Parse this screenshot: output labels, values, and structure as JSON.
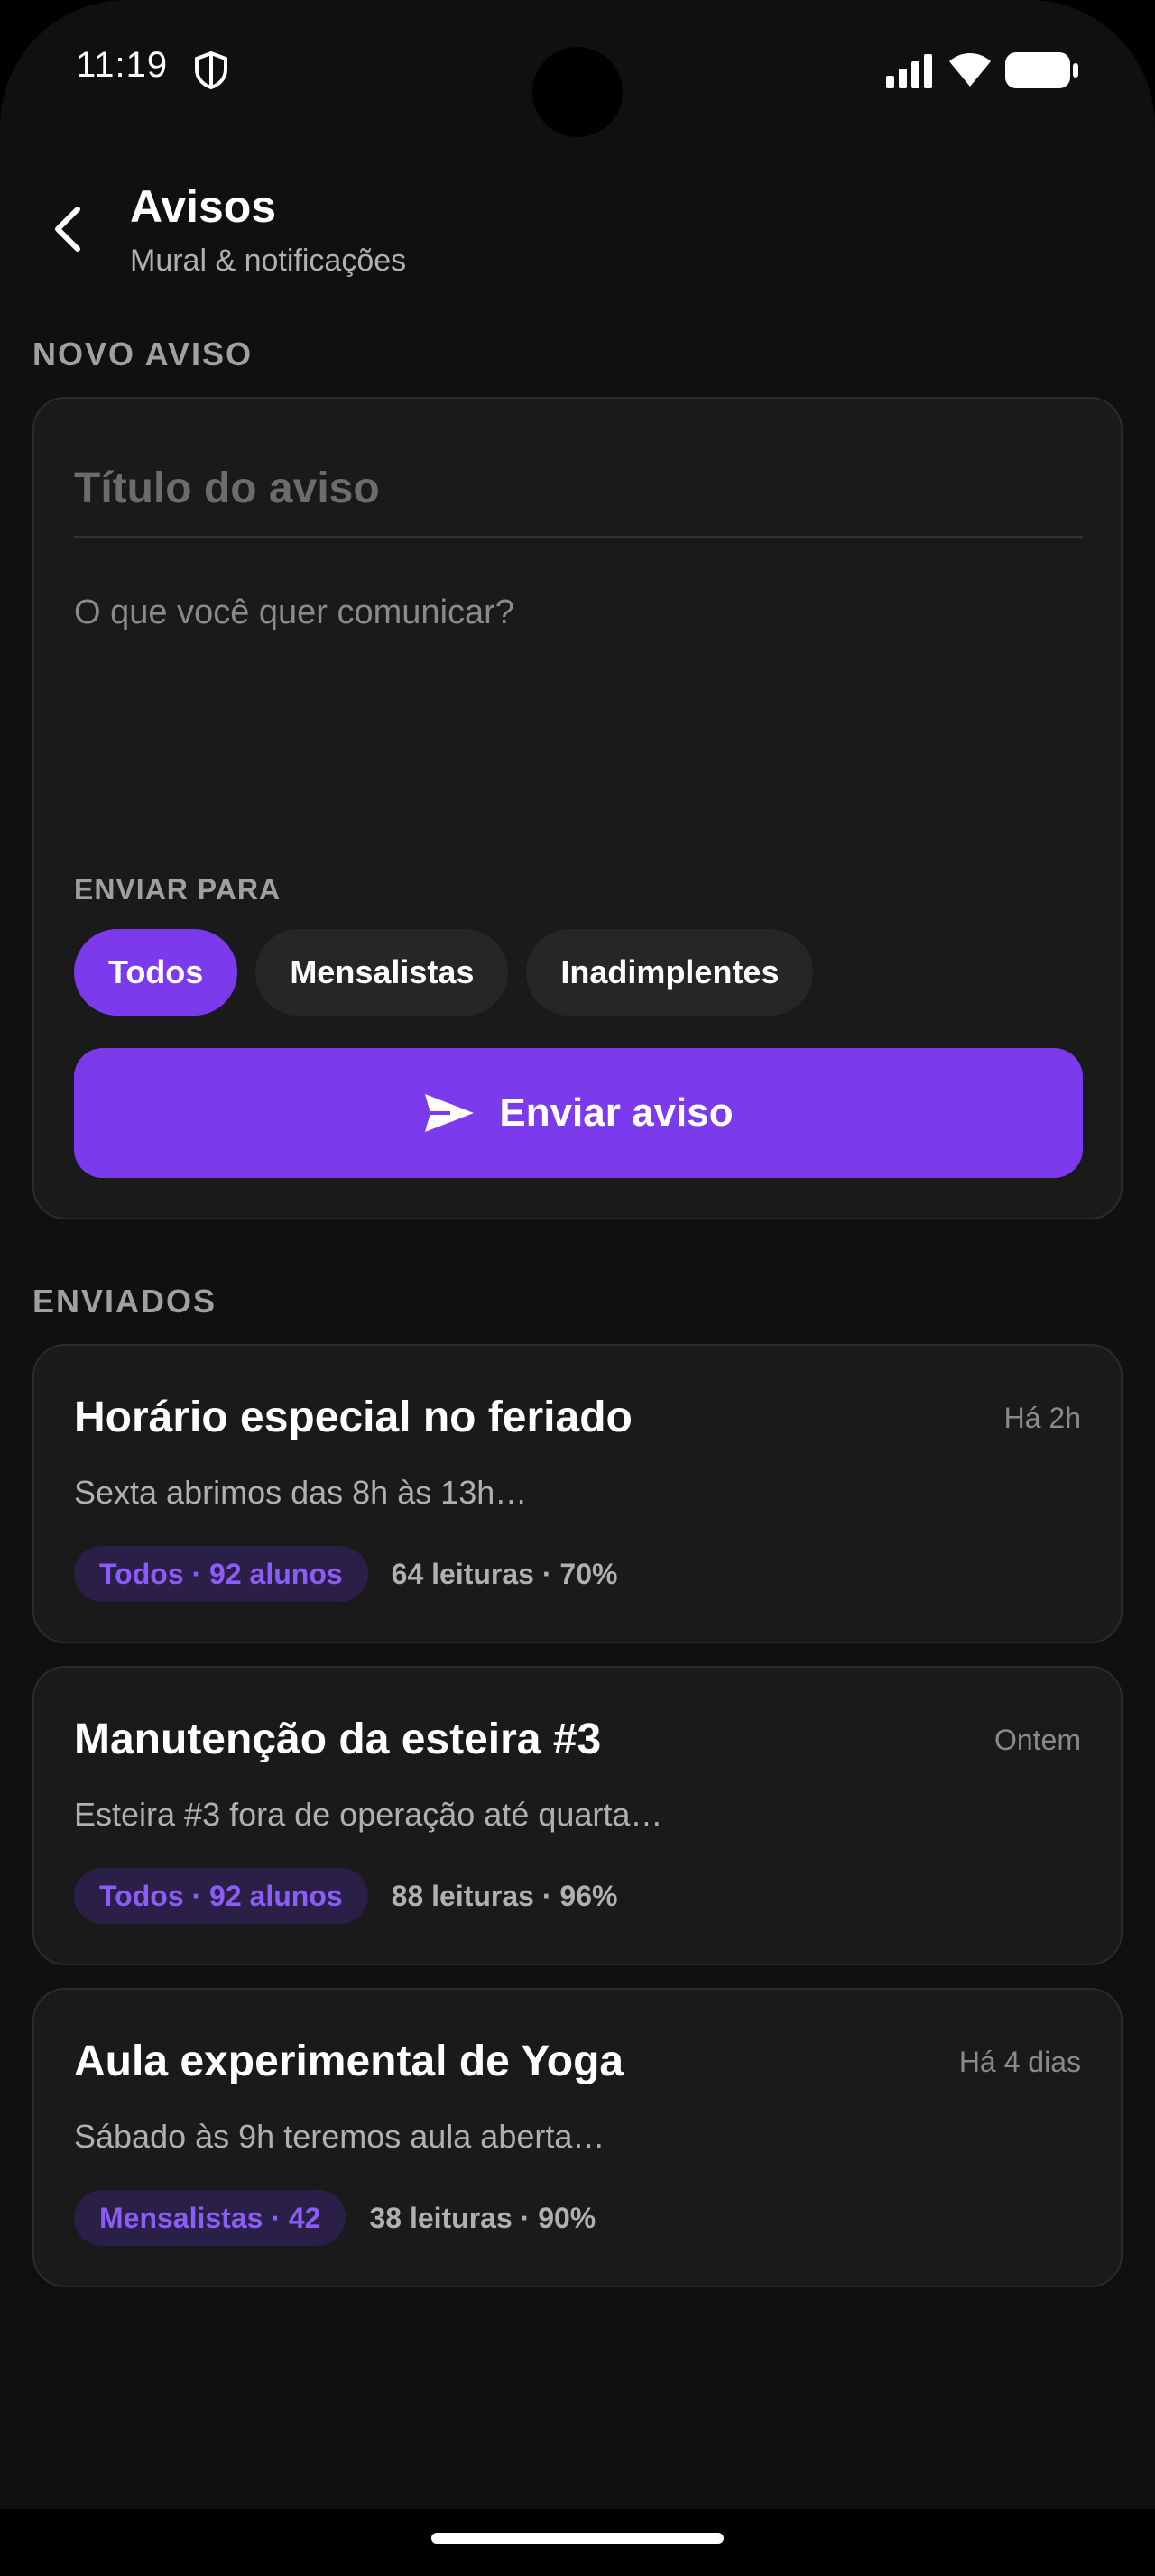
{
  "status_bar": {
    "time": "11:19",
    "icons": [
      "shield-icon",
      "signal-icon",
      "wifi-icon",
      "battery-icon"
    ]
  },
  "header": {
    "title": "Avisos",
    "subtitle": "Mural & notificações"
  },
  "compose": {
    "section_label": "NOVO AVISO",
    "title_placeholder": "Título do aviso",
    "title_value": "",
    "body_placeholder": "O que você quer comunicar?",
    "body_value": "",
    "send_to_label": "ENVIAR PARA",
    "audience_options": [
      {
        "label": "Todos",
        "selected": true
      },
      {
        "label": "Mensalistas",
        "selected": false
      },
      {
        "label": "Inadimplentes",
        "selected": false
      }
    ],
    "send_button_label": "Enviar aviso"
  },
  "sent": {
    "section_label": "ENVIADOS",
    "notices": [
      {
        "title": "Horário especial no feriado",
        "time": "Há 2h",
        "preview": "Sexta abrimos das 8h às 13h…",
        "audience": "Todos · 92 alunos",
        "reads": "64 leituras · 70%"
      },
      {
        "title": "Manutenção da esteira #3",
        "time": "Ontem",
        "preview": "Esteira #3 fora de operação até quarta…",
        "audience": "Todos · 92 alunos",
        "reads": "88 leituras · 96%"
      },
      {
        "title": "Aula experimental de Yoga",
        "time": "Há 4 dias",
        "preview": "Sábado às 9h teremos aula aberta…",
        "audience": "Mensalistas · 42",
        "reads": "38 leituras · 90%"
      }
    ]
  },
  "colors": {
    "accent": "#7c3aed",
    "badge_bg": "#2a1f47",
    "badge_text": "#8b5cf6",
    "background": "#101010",
    "card": "#1a1a1a"
  }
}
